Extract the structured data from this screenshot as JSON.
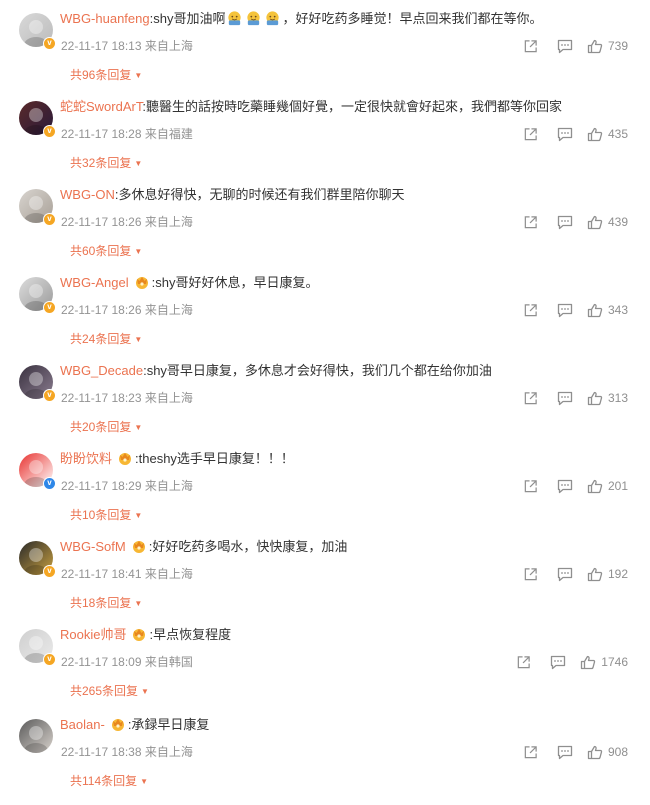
{
  "comments": [
    {
      "user": "WBG-huanfeng",
      "text_before": ":shy哥加油啊",
      "emoji_count": 3,
      "text_after": "，好好吃药多睡觉！早点回来我们都在等你。",
      "time": "22-11-17 18:13",
      "location": "来自上海",
      "likes": "739",
      "replies": "共96条回复",
      "medal": false,
      "badge": "orange"
    },
    {
      "user": "蛇蛇SwordArT",
      "text_before": ":聽醫生的話按時吃藥睡幾個好覺，一定很快就會好起來，我們都等你回家",
      "time": "22-11-17 18:28",
      "location": "来自福建",
      "likes": "435",
      "replies": "共32条回复",
      "medal": false,
      "badge": "orange"
    },
    {
      "user": "WBG-ON",
      "text_before": ":多休息好得快，无聊的时候还有我们群里陪你聊天",
      "time": "22-11-17 18:26",
      "location": "来自上海",
      "likes": "439",
      "replies": "共60条回复",
      "medal": false,
      "badge": "orange"
    },
    {
      "user": "WBG-Angel",
      "text_before": ":shy哥好好休息，早日康复。",
      "time": "22-11-17 18:26",
      "location": "来自上海",
      "likes": "343",
      "replies": "共24条回复",
      "medal": true,
      "badge": "orange"
    },
    {
      "user": "WBG_Decade",
      "text_before": ":shy哥早日康复，多休息才会好得快，我们几个都在给你加油",
      "time": "22-11-17 18:23",
      "location": "来自上海",
      "likes": "313",
      "replies": "共20条回复",
      "medal": false,
      "badge": "orange"
    },
    {
      "user": "盼盼饮料",
      "text_before": ":theshy选手早日康复！！！",
      "time": "22-11-17 18:29",
      "location": "来自上海",
      "likes": "201",
      "replies": "共10条回复",
      "medal": true,
      "badge": "blue"
    },
    {
      "user": "WBG-SofM",
      "text_before": ":好好吃药多喝水，快快康复，加油",
      "time": "22-11-17 18:41",
      "location": "来自上海",
      "likes": "192",
      "replies": "共18条回复",
      "medal": true,
      "badge": "orange"
    },
    {
      "user": "Rookie帅哥",
      "text_before": ":早点恢复程度",
      "time": "22-11-17 18:09",
      "location": "来自韩国",
      "likes": "1746",
      "replies": "共265条回复",
      "medal": true,
      "badge": "orange"
    },
    {
      "user": "Baolan-",
      "text_before": ":承録早日康复",
      "time": "22-11-17 18:38",
      "location": "来自上海",
      "likes": "908",
      "replies": "共114条回复",
      "medal": true,
      "badge": "none"
    }
  ],
  "icons": {
    "share": "share-icon",
    "reply": "comment-icon",
    "like": "thumbs-up-icon",
    "medal": "crown-medal-icon",
    "verified": "verified-badge-icon"
  },
  "colors": {
    "username": "#eb7350",
    "meta": "#939393",
    "icon": "#8f8f8f",
    "text": "#333333"
  }
}
